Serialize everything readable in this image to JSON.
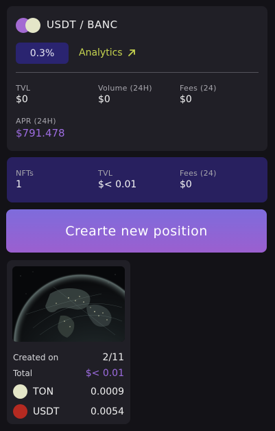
{
  "pool": {
    "pair": "USDT / BANC",
    "fee_tier": "0.3%",
    "analytics_label": "Analytics",
    "stats": {
      "tvl_label": "TVL",
      "tvl_value": "$0",
      "volume_label": "Volume (24H)",
      "volume_value": "$0",
      "fees_label": "Fees (24)",
      "fees_value": "$0",
      "apr_label": "APR (24H)",
      "apr_value": "$791.478"
    },
    "token_colors": [
      "#a36ad2",
      "#e4e6c8"
    ]
  },
  "summary": {
    "nfts_label": "NFTs",
    "nfts_value": "1",
    "tvl_label": "TVL",
    "tvl_value": "$< 0.01",
    "fees_label": "Fees (24)",
    "fees_value": "$0"
  },
  "create_button_label": "Crearte new position",
  "position": {
    "created_label": "Created on",
    "created_value": "2/11",
    "total_label": "Total",
    "total_value": "$< 0.01",
    "tokens": [
      {
        "name": "TON",
        "amount": "0.0009",
        "color": "#e4e6c8"
      },
      {
        "name": "USDT",
        "amount": "0.0054",
        "color": "#b42a21"
      }
    ]
  },
  "colors": {
    "accent_purple": "#9d6ce0",
    "analytics_green": "#c5d34f",
    "badge_bg": "#2a2470",
    "summary_bg": "#28205f"
  }
}
